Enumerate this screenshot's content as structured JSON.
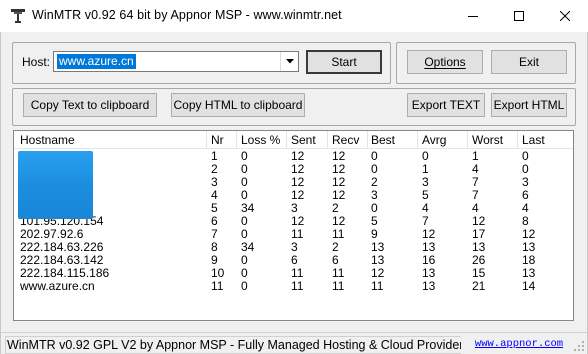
{
  "window": {
    "title": "WinMTR v0.92 64 bit by Appnor MSP - www.winmtr.net"
  },
  "host": {
    "label": "Host:",
    "value": "www.azure.cn"
  },
  "buttons": {
    "start": "Start",
    "options": "Options",
    "exit": "Exit",
    "copy_text": "Copy Text to clipboard",
    "copy_html": "Copy HTML to clipboard",
    "export_text": "Export TEXT",
    "export_html": "Export HTML"
  },
  "table": {
    "columns": [
      "Hostname",
      "Nr",
      "Loss %",
      "Sent",
      "Recv",
      "Best",
      "Avrg",
      "Worst",
      "Last"
    ],
    "rows": [
      [
        "",
        "1",
        "0",
        "12",
        "12",
        "0",
        "0",
        "1",
        "0"
      ],
      [
        "",
        "2",
        "0",
        "12",
        "12",
        "0",
        "1",
        "4",
        "0"
      ],
      [
        "",
        "3",
        "0",
        "12",
        "12",
        "2",
        "3",
        "7",
        "3"
      ],
      [
        "",
        "4",
        "0",
        "12",
        "12",
        "3",
        "5",
        "7",
        "6"
      ],
      [
        "",
        "5",
        "34",
        "3",
        "2",
        "0",
        "4",
        "4",
        "4"
      ],
      [
        "101.95.120.154",
        "6",
        "0",
        "12",
        "12",
        "5",
        "7",
        "12",
        "8"
      ],
      [
        "202.97.92.6",
        "7",
        "0",
        "11",
        "11",
        "9",
        "12",
        "17",
        "12"
      ],
      [
        "222.184.63.226",
        "8",
        "34",
        "3",
        "2",
        "13",
        "13",
        "13",
        "13"
      ],
      [
        "222.184.63.142",
        "9",
        "0",
        "6",
        "6",
        "13",
        "16",
        "26",
        "18"
      ],
      [
        "222.184.115.186",
        "10",
        "0",
        "11",
        "11",
        "12",
        "13",
        "15",
        "13"
      ],
      [
        "www.azure.cn",
        "11",
        "0",
        "11",
        "11",
        "11",
        "13",
        "21",
        "14"
      ]
    ]
  },
  "status": {
    "text": "WinMTR v0.92 GPL V2 by Appnor MSP - Fully Managed Hosting & Cloud Provider",
    "link": "www.appnor.com"
  },
  "colors": {
    "selection": "#0078d7",
    "link": "#0000ff",
    "redaction": "#1a8fdf"
  }
}
